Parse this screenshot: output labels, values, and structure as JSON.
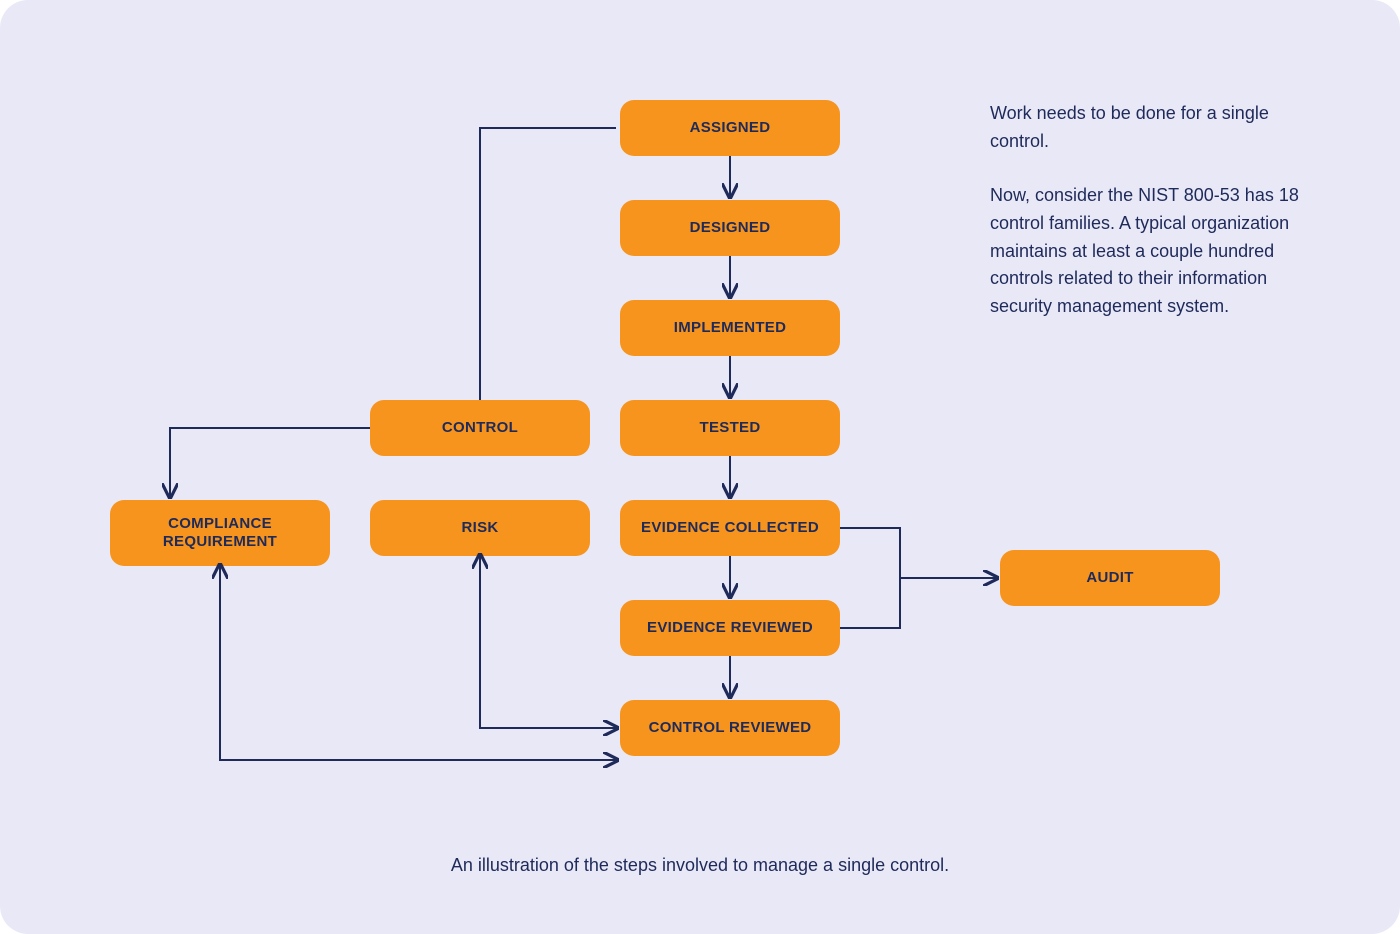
{
  "nodes": {
    "assigned": "ASSIGNED",
    "designed": "DESIGNED",
    "implemented": "IMPLEMENTED",
    "tested": "TESTED",
    "evidence_collected": "EVIDENCE COLLECTED",
    "evidence_reviewed": "EVIDENCE REVIEWED",
    "control_reviewed": "CONTROL REVIEWED",
    "control": "CONTROL",
    "risk": "RISK",
    "compliance_requirement": "COMPLIANCE REQUIREMENT",
    "audit": "AUDIT"
  },
  "side_text": {
    "p1": "Work needs to be done for a single control.",
    "p2": "Now, consider the NIST 800-53 has 18 control families. A typical organization maintains at least a couple hundred controls related to their information security management system."
  },
  "caption": "An illustration of the steps involved to manage a single control.",
  "colors": {
    "background": "#E9E8F6",
    "node_fill": "#F7941D",
    "text": "#1E2A5A",
    "connector": "#1E2A5A"
  },
  "edges": [
    {
      "from": "assigned",
      "to": "designed"
    },
    {
      "from": "designed",
      "to": "implemented"
    },
    {
      "from": "implemented",
      "to": "tested"
    },
    {
      "from": "tested",
      "to": "evidence_collected"
    },
    {
      "from": "evidence_collected",
      "to": "evidence_reviewed"
    },
    {
      "from": "evidence_reviewed",
      "to": "control_reviewed"
    },
    {
      "from": "control",
      "to": "assigned"
    },
    {
      "from": "control",
      "to": "compliance_requirement"
    },
    {
      "from": "compliance_requirement",
      "to": "control_reviewed"
    },
    {
      "from": "risk",
      "to": "control_reviewed"
    },
    {
      "from": "evidence_collected",
      "to": "audit"
    },
    {
      "from": "evidence_reviewed",
      "to": "audit"
    }
  ]
}
